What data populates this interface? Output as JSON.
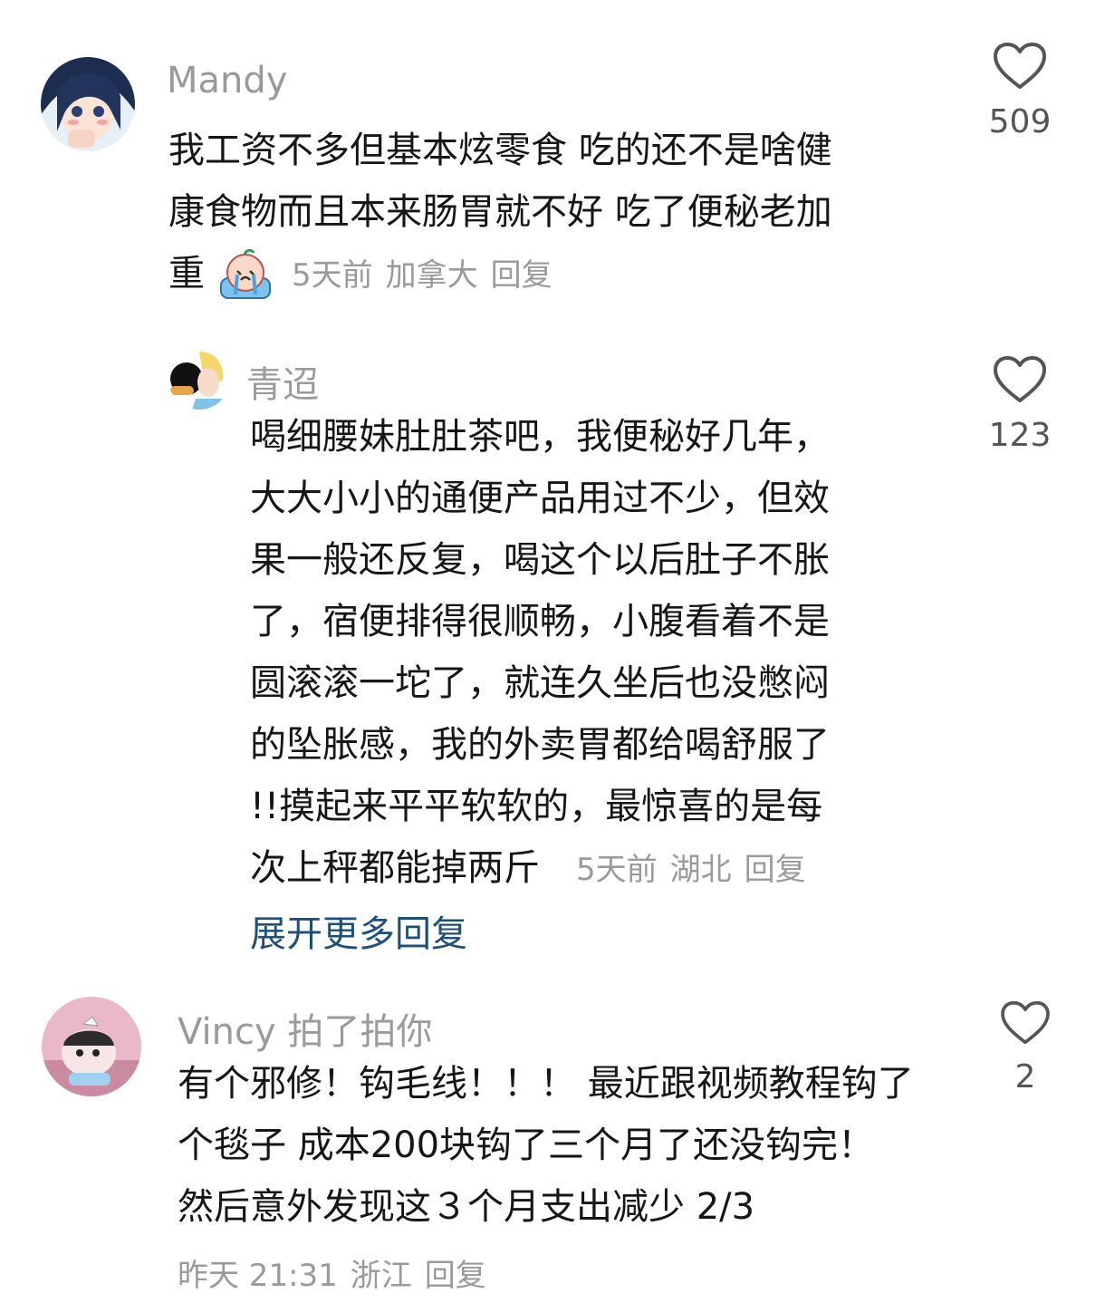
{
  "comments": [
    {
      "username": "Mandy",
      "text_lines": [
        "我工资不多但基本炫零食 吃的还不是啥健",
        "康食物而且本来肠胃就不好 吃了便秘老加",
        "重"
      ],
      "emoji": "crying-face-icon",
      "time": "5天前",
      "location": "加拿大",
      "reply_label": "回复",
      "likes": "509"
    },
    {
      "username": "青迢",
      "text_lines": [
        "喝细腰妹肚肚茶吧，我便秘好几年，",
        "大大小小的通便产品用过不少，但效",
        "果一般还反复，喝这个以后肚子不胀",
        "了，宿便排得很顺畅，小腹看着不是",
        "圆滚滚一坨了，就连久坐后也没憋闷",
        "的坠胀感，我的外卖胃都给喝舒服了",
        "!!摸起来平平软软的，最惊喜的是每",
        "次上秤都能掉两斤"
      ],
      "time": "5天前",
      "location": "湖北",
      "reply_label": "回复",
      "likes": "123",
      "expand_label": "展开更多回复"
    },
    {
      "username": "Vincy 拍了拍你",
      "text_lines": [
        "有个邪修！钩毛线！！！ 最近跟视频教程钩了",
        "个毯子 成本200块钩了三个月了还没钩完！",
        "然后意外发现这３个月支出减少 2/3"
      ],
      "time": "昨天 21:31",
      "location": "浙江",
      "reply_label": "回复",
      "likes": "2"
    }
  ],
  "colors": {
    "text": "#161616",
    "muted": "#9a9a9a",
    "link": "#1f4e79",
    "heart": "#555555"
  }
}
